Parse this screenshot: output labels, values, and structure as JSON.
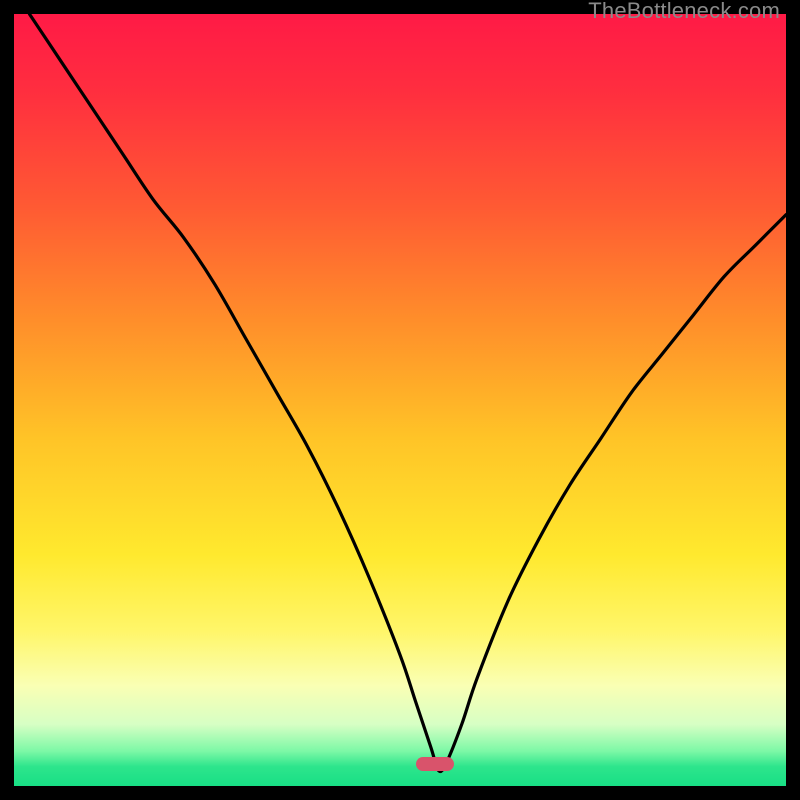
{
  "watermark": "TheBottleneck.com",
  "marker": {
    "color": "#d9536b",
    "x_frac": 0.545,
    "y_frac": 0.972
  },
  "gradient_stops": [
    {
      "offset": 0.0,
      "color": "#ff1a46"
    },
    {
      "offset": 0.1,
      "color": "#ff2e3f"
    },
    {
      "offset": 0.25,
      "color": "#ff5a33"
    },
    {
      "offset": 0.4,
      "color": "#ff8f2a"
    },
    {
      "offset": 0.55,
      "color": "#ffc427"
    },
    {
      "offset": 0.7,
      "color": "#ffe92e"
    },
    {
      "offset": 0.8,
      "color": "#fff66a"
    },
    {
      "offset": 0.87,
      "color": "#faffb4"
    },
    {
      "offset": 0.92,
      "color": "#d7ffc4"
    },
    {
      "offset": 0.955,
      "color": "#7cf8a6"
    },
    {
      "offset": 0.975,
      "color": "#2de58c"
    },
    {
      "offset": 1.0,
      "color": "#18df85"
    }
  ],
  "chart_data": {
    "type": "line",
    "title": "",
    "xlabel": "",
    "ylabel": "",
    "xlim": [
      0,
      100
    ],
    "ylim": [
      0,
      100
    ],
    "legend": false,
    "grid": false,
    "series": [
      {
        "name": "bottleneck-curve",
        "x": [
          2,
          6,
          10,
          14,
          18,
          22,
          26,
          30,
          34,
          38,
          42,
          46,
          50,
          52,
          54,
          55,
          56,
          58,
          60,
          64,
          68,
          72,
          76,
          80,
          84,
          88,
          92,
          96,
          100
        ],
        "y": [
          100,
          94,
          88,
          82,
          76,
          71,
          65,
          58,
          51,
          44,
          36,
          27,
          17,
          11,
          5,
          2,
          3,
          8,
          14,
          24,
          32,
          39,
          45,
          51,
          56,
          61,
          66,
          70,
          74
        ]
      }
    ],
    "annotations": [
      {
        "type": "pill",
        "x": 54.5,
        "y": 2.8,
        "color": "#d9536b"
      }
    ]
  }
}
